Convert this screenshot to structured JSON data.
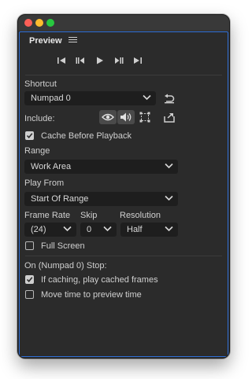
{
  "panel": {
    "title": "Preview"
  },
  "shortcut": {
    "label": "Shortcut",
    "value": "Numpad 0"
  },
  "include": {
    "label": "Include:"
  },
  "cache_before_playback": {
    "label": "Cache Before Playback",
    "checked": true
  },
  "range": {
    "label": "Range",
    "value": "Work Area"
  },
  "play_from": {
    "label": "Play From",
    "value": "Start Of Range"
  },
  "frame_rate": {
    "label": "Frame Rate",
    "value": "(24)"
  },
  "skip": {
    "label": "Skip",
    "value": "0"
  },
  "resolution": {
    "label": "Resolution",
    "value": "Half"
  },
  "full_screen": {
    "label": "Full Screen",
    "checked": false
  },
  "stop": {
    "label": "On (Numpad 0) Stop:",
    "play_cached": {
      "label": "If caching, play cached frames",
      "checked": true
    },
    "move_time": {
      "label": "Move time to preview time",
      "checked": false
    }
  },
  "icons": {
    "transport": [
      "first-frame-icon",
      "previous-frame-icon",
      "play-icon",
      "next-frame-icon",
      "last-frame-icon"
    ],
    "include": [
      "eye-video-icon",
      "speaker-audio-icon",
      "overlays-icon"
    ]
  },
  "colors": {
    "accent": "#2f6fd8",
    "panel_bg": "#2b2b2b",
    "field_bg": "#1e1e1e"
  }
}
